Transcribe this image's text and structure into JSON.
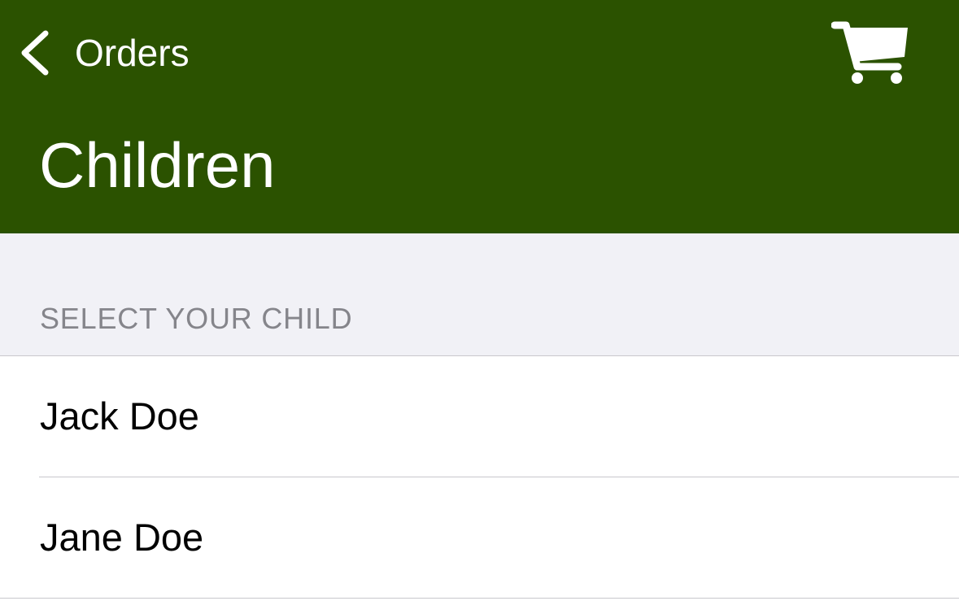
{
  "nav": {
    "back_label": "Orders",
    "back_icon": "chevron-left-icon",
    "cart_icon": "shopping-cart-icon",
    "title": "Children",
    "bar_color": "#2b5200"
  },
  "section": {
    "header": "SELECT YOUR CHILD"
  },
  "children": [
    {
      "name": "Jack Doe"
    },
    {
      "name": "Jane Doe"
    }
  ]
}
